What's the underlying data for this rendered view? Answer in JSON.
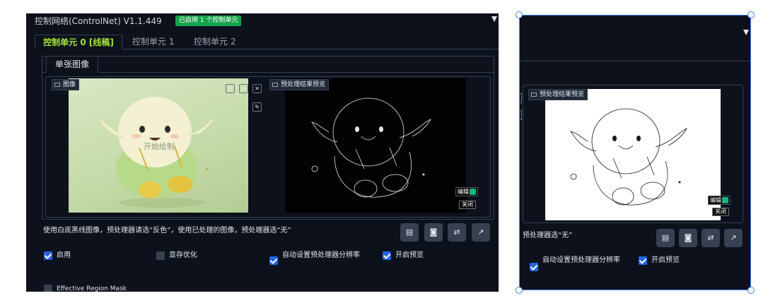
{
  "left_panel": {
    "title": "控制网络(ControlNet) V1.1.449",
    "enabled_badge": "已启用 1 个控制单元",
    "tabs": [
      "控制单元 0 [线稿]",
      "控制单元 1",
      "控制单元 2"
    ],
    "subtab": "单张图像",
    "image_label": "图像",
    "preview_label": "预处理结果预览",
    "watermark": "开始绘制",
    "edit_label": "编辑",
    "close_label": "关闭",
    "hint": "使用白底黑线图像，预处理器请选“反色”，使用已处理的图像，预处理器选“无”",
    "checkboxes": {
      "enable": "启用",
      "lowvram": "显存优化",
      "pixel_perfect": "自动设置预处理器分辨率",
      "preview": "开启预览",
      "region_mask": "Effective Region Mask"
    }
  },
  "right_panel": {
    "preview_label": "预处理结果预览",
    "edit_label": "编辑",
    "close_label": "关闭",
    "hint": "预处理器选“无”",
    "checkboxes": {
      "pixel_perfect": "自动设置预处理器分辨率",
      "preview": "开启预览"
    }
  },
  "colors": {
    "panel_bg": "#0c111c",
    "accent_green": "#a3e635",
    "badge_green": "#16a34a",
    "checkbox_blue": "#2563eb",
    "selection_blue": "#3b82f6"
  }
}
